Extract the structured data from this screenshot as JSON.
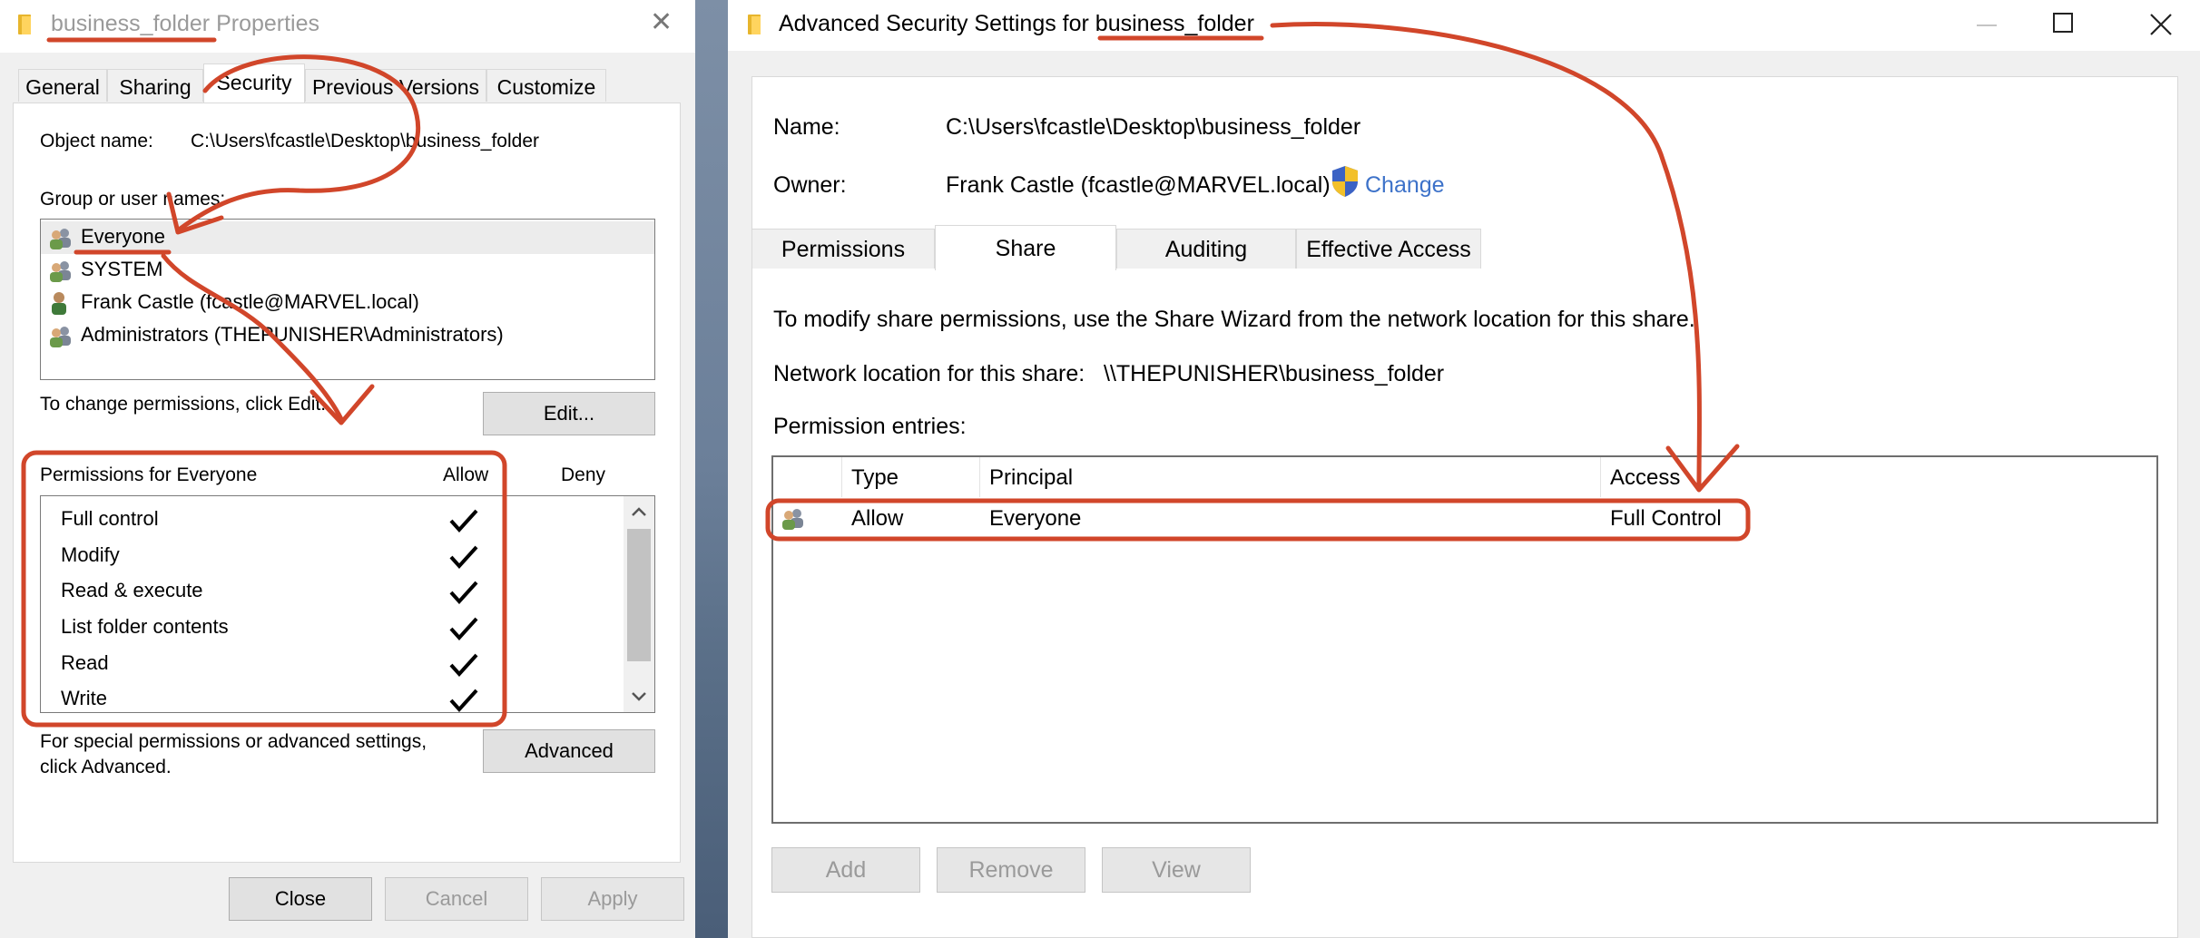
{
  "colors": {
    "annotation": "#d1462a",
    "link": "#3d72c9",
    "dialog_bg": "#f0f0f0"
  },
  "properties": {
    "title_folder": "business_folder",
    "title_suffix": " Properties",
    "tabs": [
      "General",
      "Sharing",
      "Security",
      "Previous Versions",
      "Customize"
    ],
    "selected_tab": "Security",
    "object_name_label": "Object name:",
    "object_name_value": "C:\\Users\\fcastle\\Desktop\\business_folder",
    "group_label": "Group or user names:",
    "users": [
      {
        "label": "Everyone",
        "icon": "group-icon"
      },
      {
        "label": "SYSTEM",
        "icon": "group-icon"
      },
      {
        "label": "Frank Castle (fcastle@MARVEL.local)",
        "icon": "user-icon"
      },
      {
        "label": "Administrators (THEPUNISHER\\Administrators)",
        "icon": "group-icon"
      }
    ],
    "change_text": "To change permissions, click Edit.",
    "edit_button": "Edit...",
    "permissions_header": "Permissions for Everyone",
    "allow_header": "Allow",
    "deny_header": "Deny",
    "permissions": [
      {
        "name": "Full control",
        "allow": true,
        "deny": false
      },
      {
        "name": "Modify",
        "allow": true,
        "deny": false
      },
      {
        "name": "Read & execute",
        "allow": true,
        "deny": false
      },
      {
        "name": "List folder contents",
        "allow": true,
        "deny": false
      },
      {
        "name": "Read",
        "allow": true,
        "deny": false
      },
      {
        "name": "Write",
        "allow": true,
        "deny": false
      }
    ],
    "special_text_1": "For special permissions or advanced settings,",
    "special_text_2": "click Advanced.",
    "advanced_button": "Advanced",
    "close_button": "Close",
    "cancel_button": "Cancel",
    "apply_button": "Apply"
  },
  "advanced": {
    "title_prefix": "Advanced Security Settings for ",
    "title_folder": "business_folder",
    "name_label": "Name:",
    "name_value": "C:\\Users\\fcastle\\Desktop\\business_folder",
    "owner_label": "Owner:",
    "owner_value": "Frank Castle (fcastle@MARVEL.local)",
    "change_link": "Change",
    "tabs": [
      "Permissions",
      "Share",
      "Auditing",
      "Effective Access"
    ],
    "selected_tab": "Share",
    "info_text": "To modify share permissions, use the Share Wizard from the network location for this share.",
    "network_label": "Network location for this share:",
    "network_value": "\\\\THEPUNISHER\\business_folder",
    "entries_label": "Permission entries:",
    "columns": [
      "Type",
      "Principal",
      "Access"
    ],
    "entries": [
      {
        "type": "Allow",
        "principal": "Everyone",
        "access": "Full Control"
      }
    ],
    "add_button": "Add",
    "remove_button": "Remove",
    "view_button": "View"
  }
}
